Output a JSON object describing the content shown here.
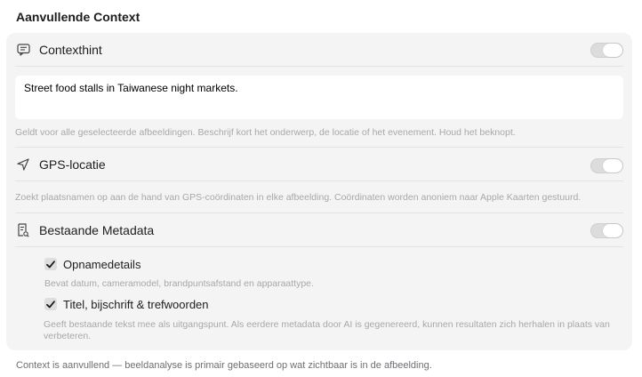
{
  "section": {
    "title": "Aanvullende Context"
  },
  "context_hint": {
    "label": "Contexthint",
    "icon": "message-icon",
    "enabled": true,
    "value": "Street food stalls in Taiwanese night markets.",
    "help": "Geldt voor alle geselecteerde afbeeldingen. Beschrijf kort het onderwerp, de locatie of het evenement. Houd het beknopt."
  },
  "gps": {
    "label": "GPS-locatie",
    "icon": "location-arrow-icon",
    "enabled": true,
    "help": "Zoekt plaatsnamen op aan de hand van GPS-coördinaten in elke afbeelding. Coördinaten worden anoniem naar Apple Kaarten gestuurd."
  },
  "metadata": {
    "label": "Bestaande Metadata",
    "icon": "document-search-icon",
    "enabled": true,
    "options": [
      {
        "label": "Opnamedetails",
        "checked": true,
        "help": "Bevat datum, cameramodel, brandpuntsafstand en apparaattype."
      },
      {
        "label": "Titel, bijschrift & trefwoorden",
        "checked": true,
        "help": "Geeft bestaande tekst mee als uitgangspunt. Als eerdere metadata door AI is gegenereerd, kunnen resultaten zich herhalen in plaats van verbeteren."
      }
    ]
  },
  "footer": {
    "note": "Context is aanvullend — beeldanalyse is primair gebaseerd op wat zichtbaar is in de afbeelding."
  }
}
